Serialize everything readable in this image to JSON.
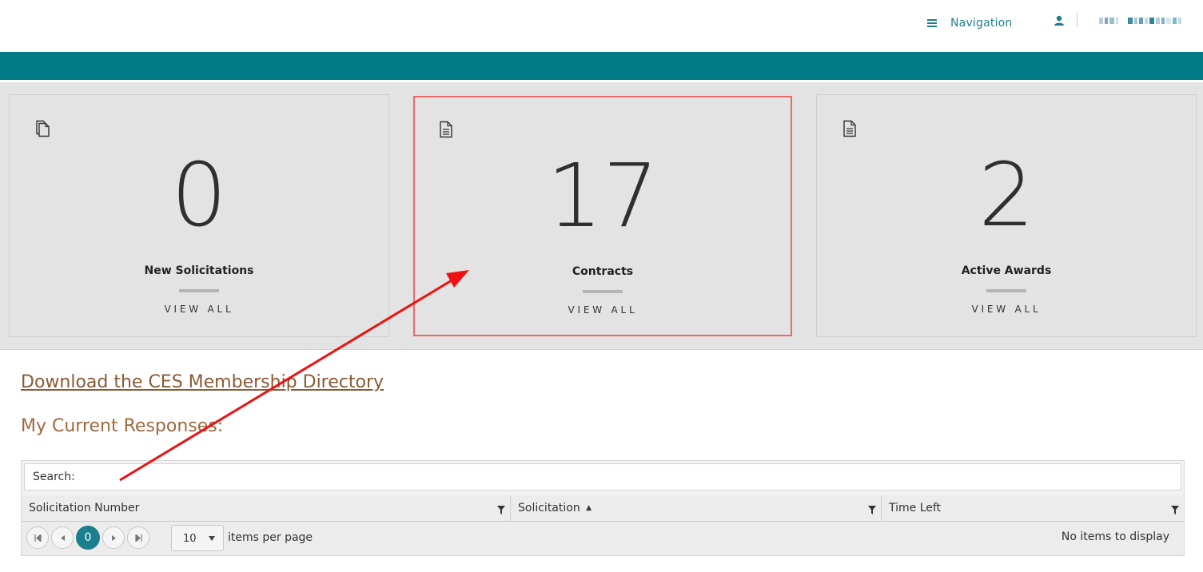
{
  "header": {
    "nav_label": "Navigation",
    "icons": {
      "menu": "hamburger-icon",
      "user": "user-icon"
    }
  },
  "cards": [
    {
      "count": "0",
      "title": "New Solicitations",
      "action": "VIEW ALL",
      "icon": "documents-icon"
    },
    {
      "count": "17",
      "title": "Contracts",
      "action": "VIEW ALL",
      "icon": "document-icon"
    },
    {
      "count": "2",
      "title": "Active Awards",
      "action": "VIEW ALL",
      "icon": "document-icon"
    }
  ],
  "content": {
    "directory_link": "Download the CES Membership Directory",
    "section_title": "My Current Responses:"
  },
  "grid": {
    "search_label": "Search:",
    "search_value": "",
    "columns": [
      {
        "label": "Solicitation Number",
        "sort": ""
      },
      {
        "label": "Solicitation",
        "sort": "▲"
      },
      {
        "label": "Time Left",
        "sort": ""
      }
    ],
    "pager": {
      "current_page": "0",
      "page_size": "10",
      "items_per_page_label": "items per page",
      "status": "No items to display"
    }
  },
  "colors": {
    "teal": "#027b89",
    "link_brown": "#8a5a33",
    "highlight_red": "#e8696b",
    "annotation_red": "#ee1111"
  }
}
